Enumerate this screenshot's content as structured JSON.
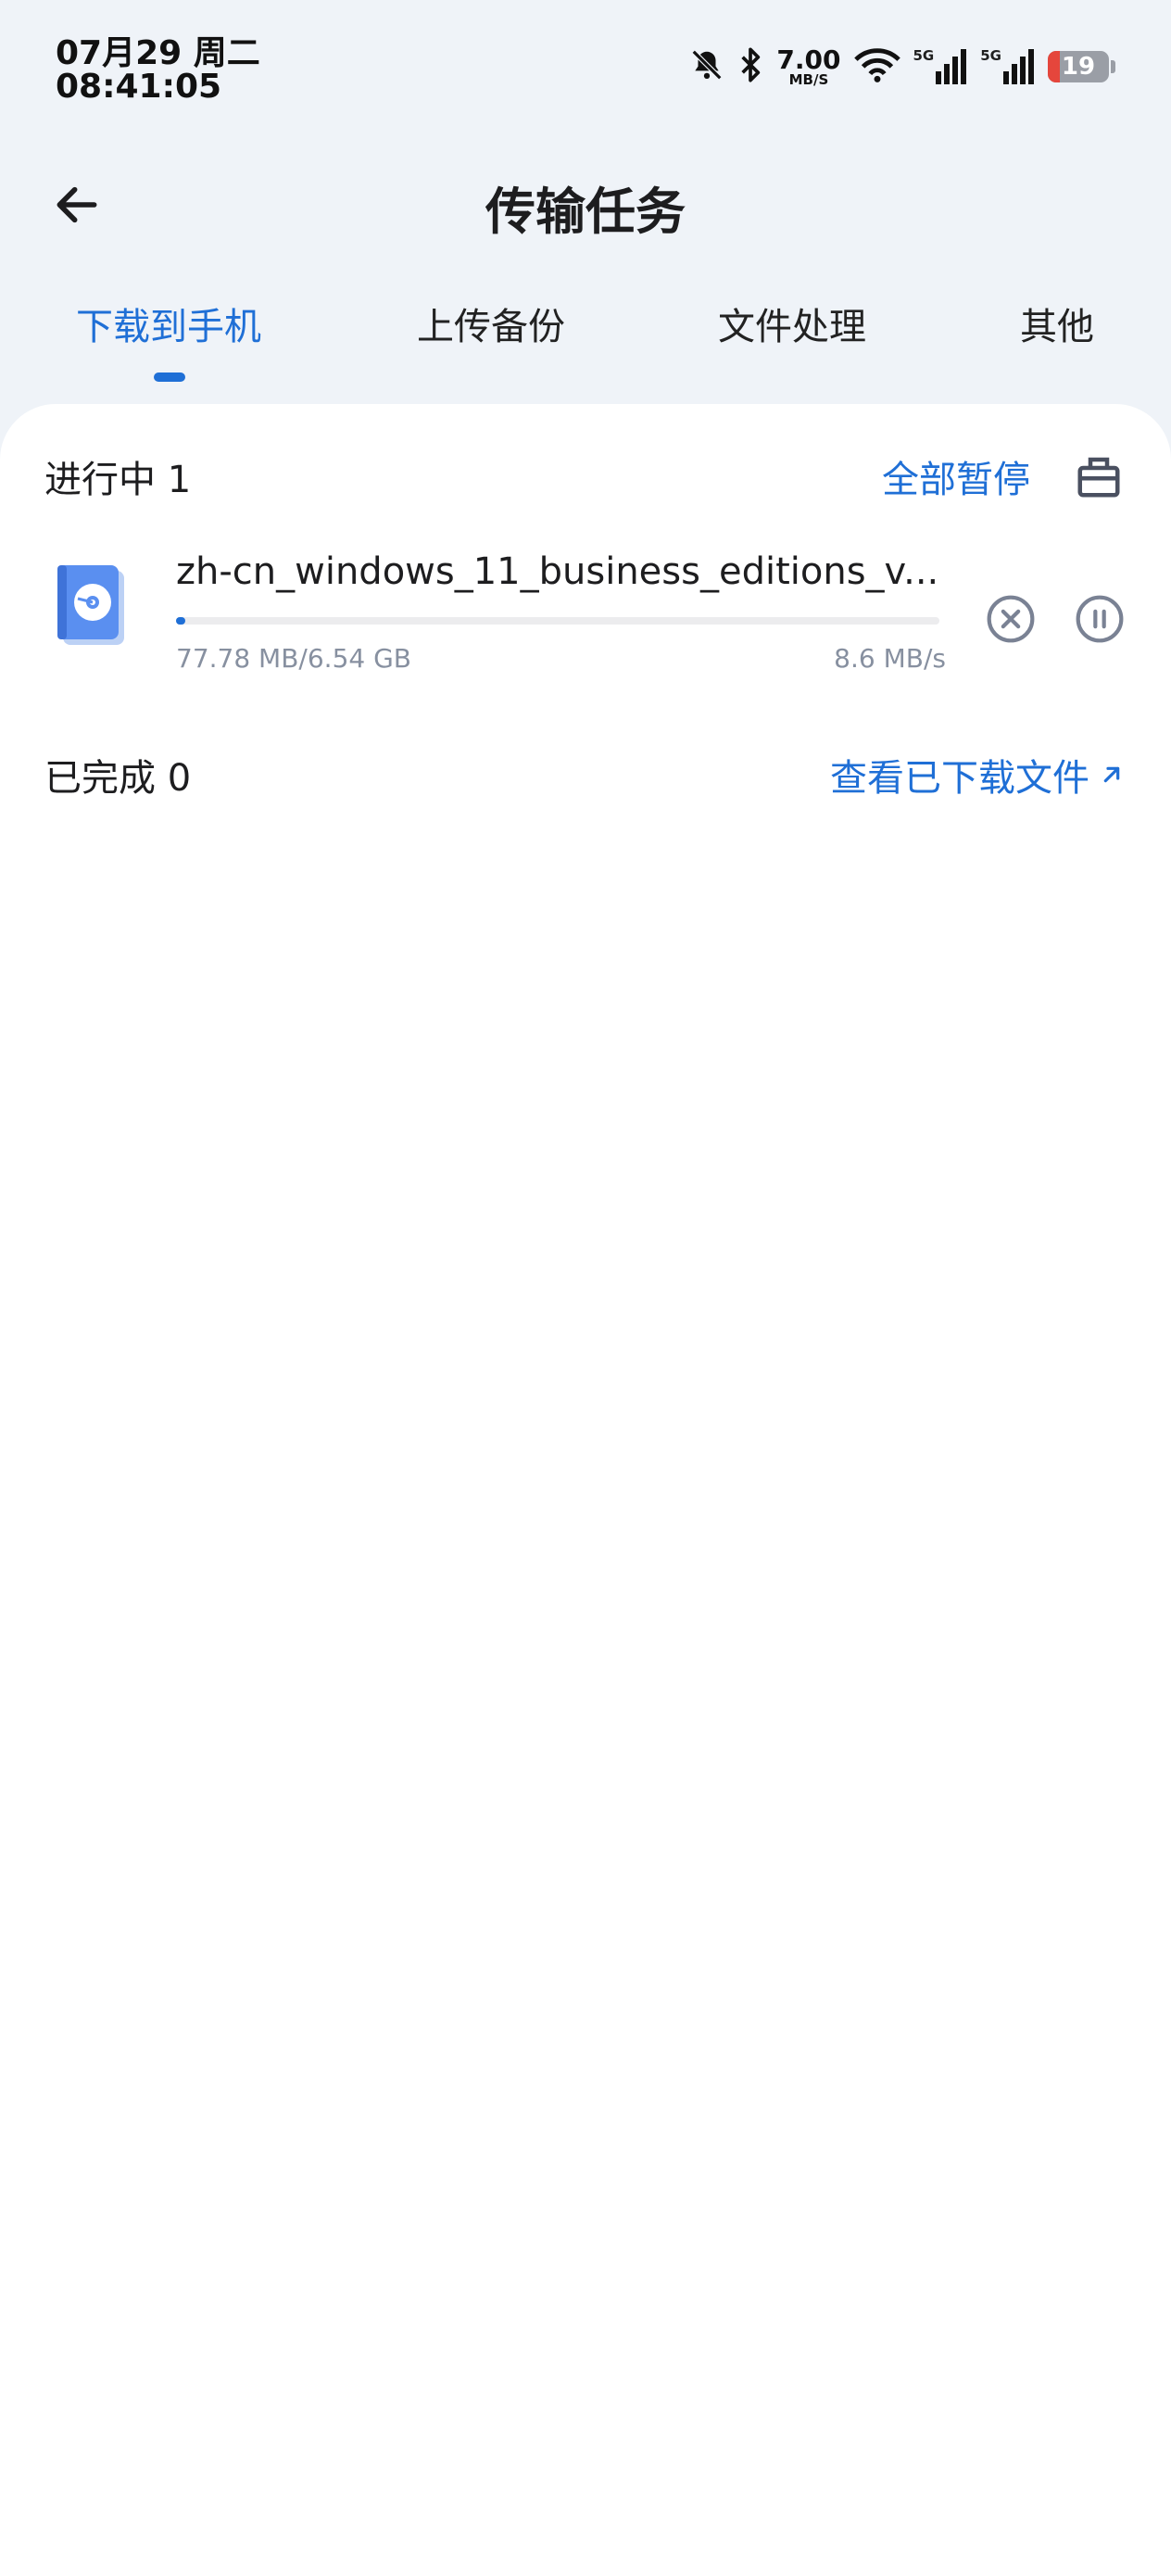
{
  "status_bar": {
    "date": "07月29 周二",
    "time": "08:41:05",
    "net_speed_value": "7.00",
    "net_speed_unit": "MB/S",
    "network1": "5G",
    "network2": "5G",
    "battery": "19",
    "battery_level": 0.19
  },
  "header": {
    "title": "传输任务"
  },
  "tabs": [
    {
      "label": "下载到手机",
      "active": true
    },
    {
      "label": "上传备份",
      "active": false
    },
    {
      "label": "文件处理",
      "active": false
    },
    {
      "label": "其他",
      "active": false
    }
  ],
  "in_progress": {
    "title": "进行中 1",
    "pause_all": "全部暂停",
    "tasks": [
      {
        "filename": "zh-cn_windows_11_business_editions_v...",
        "size": "77.78 MB/6.54 GB",
        "speed": "8.6 MB/s",
        "progress": 0.012
      }
    ]
  },
  "completed": {
    "title": "已完成 0",
    "view_files": "查看已下载文件",
    "view_icon": "arrow-up-right-icon"
  },
  "colors": {
    "accent": "#1f6fd6",
    "background": "#eff3f8",
    "card": "#ffffff",
    "muted_text": "#8790a0"
  }
}
